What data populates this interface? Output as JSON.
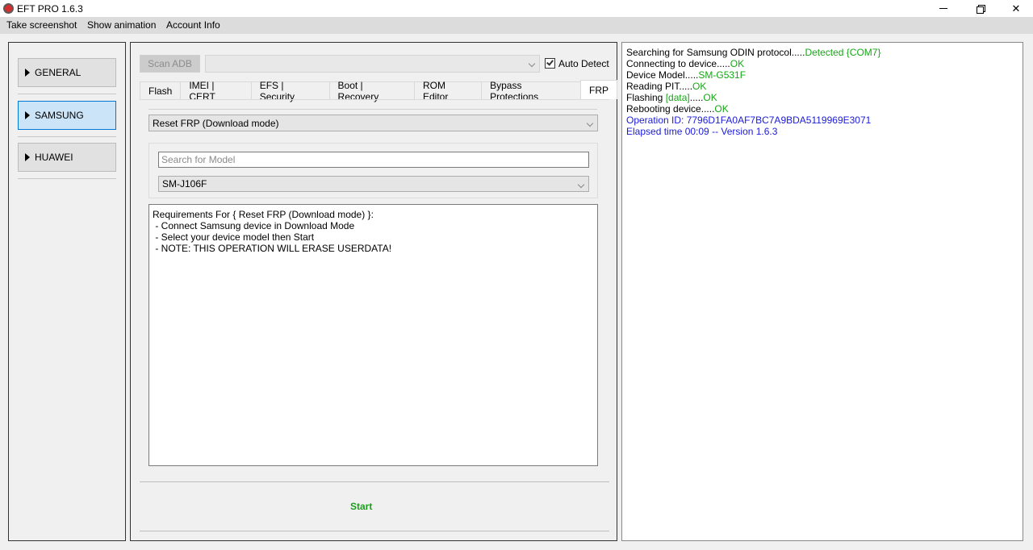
{
  "window": {
    "title": "EFT PRO 1.6.3"
  },
  "menu": {
    "items": [
      "Take screenshot",
      "Show animation",
      "Account Info"
    ]
  },
  "nav": {
    "items": [
      "GENERAL",
      "SAMSUNG",
      "HUAWEI"
    ],
    "active": "SAMSUNG"
  },
  "toolbar": {
    "scan_label": "Scan ADB",
    "port_value": "",
    "auto_detect_label": "Auto Detect",
    "auto_detect_checked": true
  },
  "tabs": [
    "Flash",
    "IMEI | CERT",
    "EFS | Security",
    "Boot | Recovery",
    "ROM Editor",
    "Bypass Protections",
    "FRP"
  ],
  "active_tab": "FRP",
  "frp": {
    "mode_value": "Reset FRP (Download mode)",
    "search_placeholder": "Search for Model",
    "model_value": "SM-J106F",
    "requirements": [
      "Requirements For { Reset FRP (Download mode) }:",
      " - Connect Samsung device in Download Mode",
      " - Select your device model then Start",
      " - NOTE: THIS OPERATION WILL ERASE USERDATA!"
    ],
    "start_label": "Start"
  },
  "log": {
    "l1_text": "Searching for Samsung ODIN protocol.....",
    "l1_status": "Detected {COM7}",
    "l2_text": "Connecting to device.....",
    "l2_status": "OK",
    "l3_text": "Device Model.....",
    "l3_status": "SM-G531F",
    "l4_text": "Reading PIT.....",
    "l4_status": "OK",
    "l5_text": "Flashing ",
    "l5_tag": "[data]",
    "l5_dots": ".....",
    "l5_status": "OK",
    "l6_text": "Rebooting device.....",
    "l6_status": "OK",
    "l7": "Operation ID: 7796D1FA0AF7BC7A9BDA5119969E3071",
    "l8": "Elapsed time 00:09 -- Version 1.6.3"
  },
  "colors": {
    "ok": "#14a814",
    "info": "#1a1adb",
    "active_nav": "#cce4f7"
  }
}
